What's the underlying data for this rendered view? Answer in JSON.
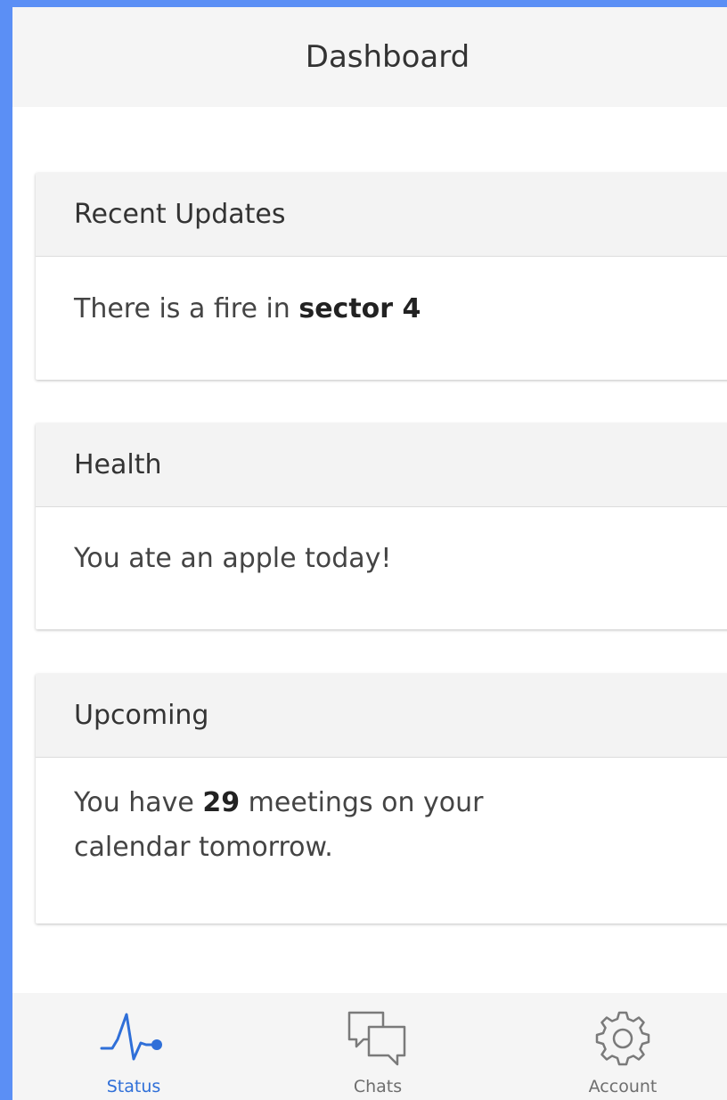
{
  "header": {
    "title": "Dashboard"
  },
  "cards": [
    {
      "title": "Recent Updates",
      "text_before": "There is a fire in ",
      "bold": "sector 4",
      "text_after": ""
    },
    {
      "title": "Health",
      "text": "You ate an apple today!"
    },
    {
      "title": "Upcoming",
      "text_before": "You have ",
      "bold": "29",
      "text_after": " meetings on your calendar tomorrow."
    }
  ],
  "tabs": [
    {
      "label": "Status",
      "icon": "pulse-icon",
      "active": true
    },
    {
      "label": "Chats",
      "icon": "chat-bubbles-icon",
      "active": false
    },
    {
      "label": "Account",
      "icon": "gear-icon",
      "active": false
    }
  ],
  "colors": {
    "frame": "#5b8ff5",
    "accent": "#2f6fd8"
  }
}
